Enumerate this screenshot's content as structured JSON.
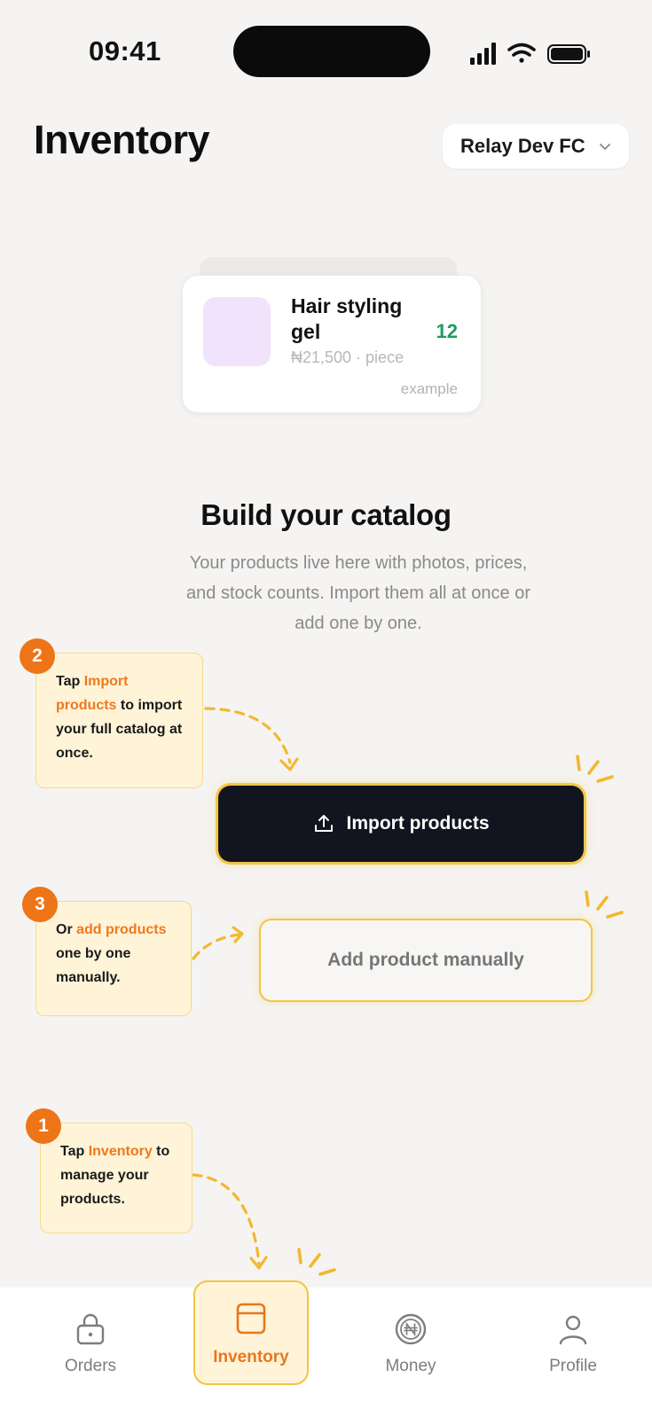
{
  "status_bar": {
    "time": "09:41"
  },
  "header": {
    "title": "Inventory",
    "team_selector": "Relay Dev FC"
  },
  "example_card": {
    "name": "Hair styling gel",
    "quantity": "12",
    "price": "₦21,500 · piece",
    "tag": "example"
  },
  "empty_state": {
    "heading": "Build your catalog",
    "description": "Your products live here with photos, prices, and stock counts. Import them all at once or add one by one."
  },
  "tips": [
    {
      "number": "1",
      "before": "Tap ",
      "highlight": "Inventory",
      "after": " to manage your products."
    },
    {
      "number": "2",
      "before": "Tap ",
      "highlight": "Import products",
      "after": " to import your full catalog at once."
    },
    {
      "number": "3",
      "before": "Or ",
      "highlight": "add products",
      "after": " one by one manually."
    }
  ],
  "actions": {
    "import_label": "Import products",
    "add_label": "Add product manually"
  },
  "tab_bar": {
    "items": [
      {
        "label": "Orders",
        "icon": "lock-bag-icon"
      },
      {
        "label": "Inventory",
        "icon": "inventory-box-icon",
        "active": true
      },
      {
        "label": "Money",
        "icon": "naira-coin-icon"
      },
      {
        "label": "Profile",
        "icon": "person-icon"
      }
    ]
  },
  "colors": {
    "accent": "#ee7418",
    "highlight_border": "#f4c542",
    "tip_background": "#fff4d8",
    "stock_green": "#1a9e5a",
    "primary_button": "#121520"
  }
}
